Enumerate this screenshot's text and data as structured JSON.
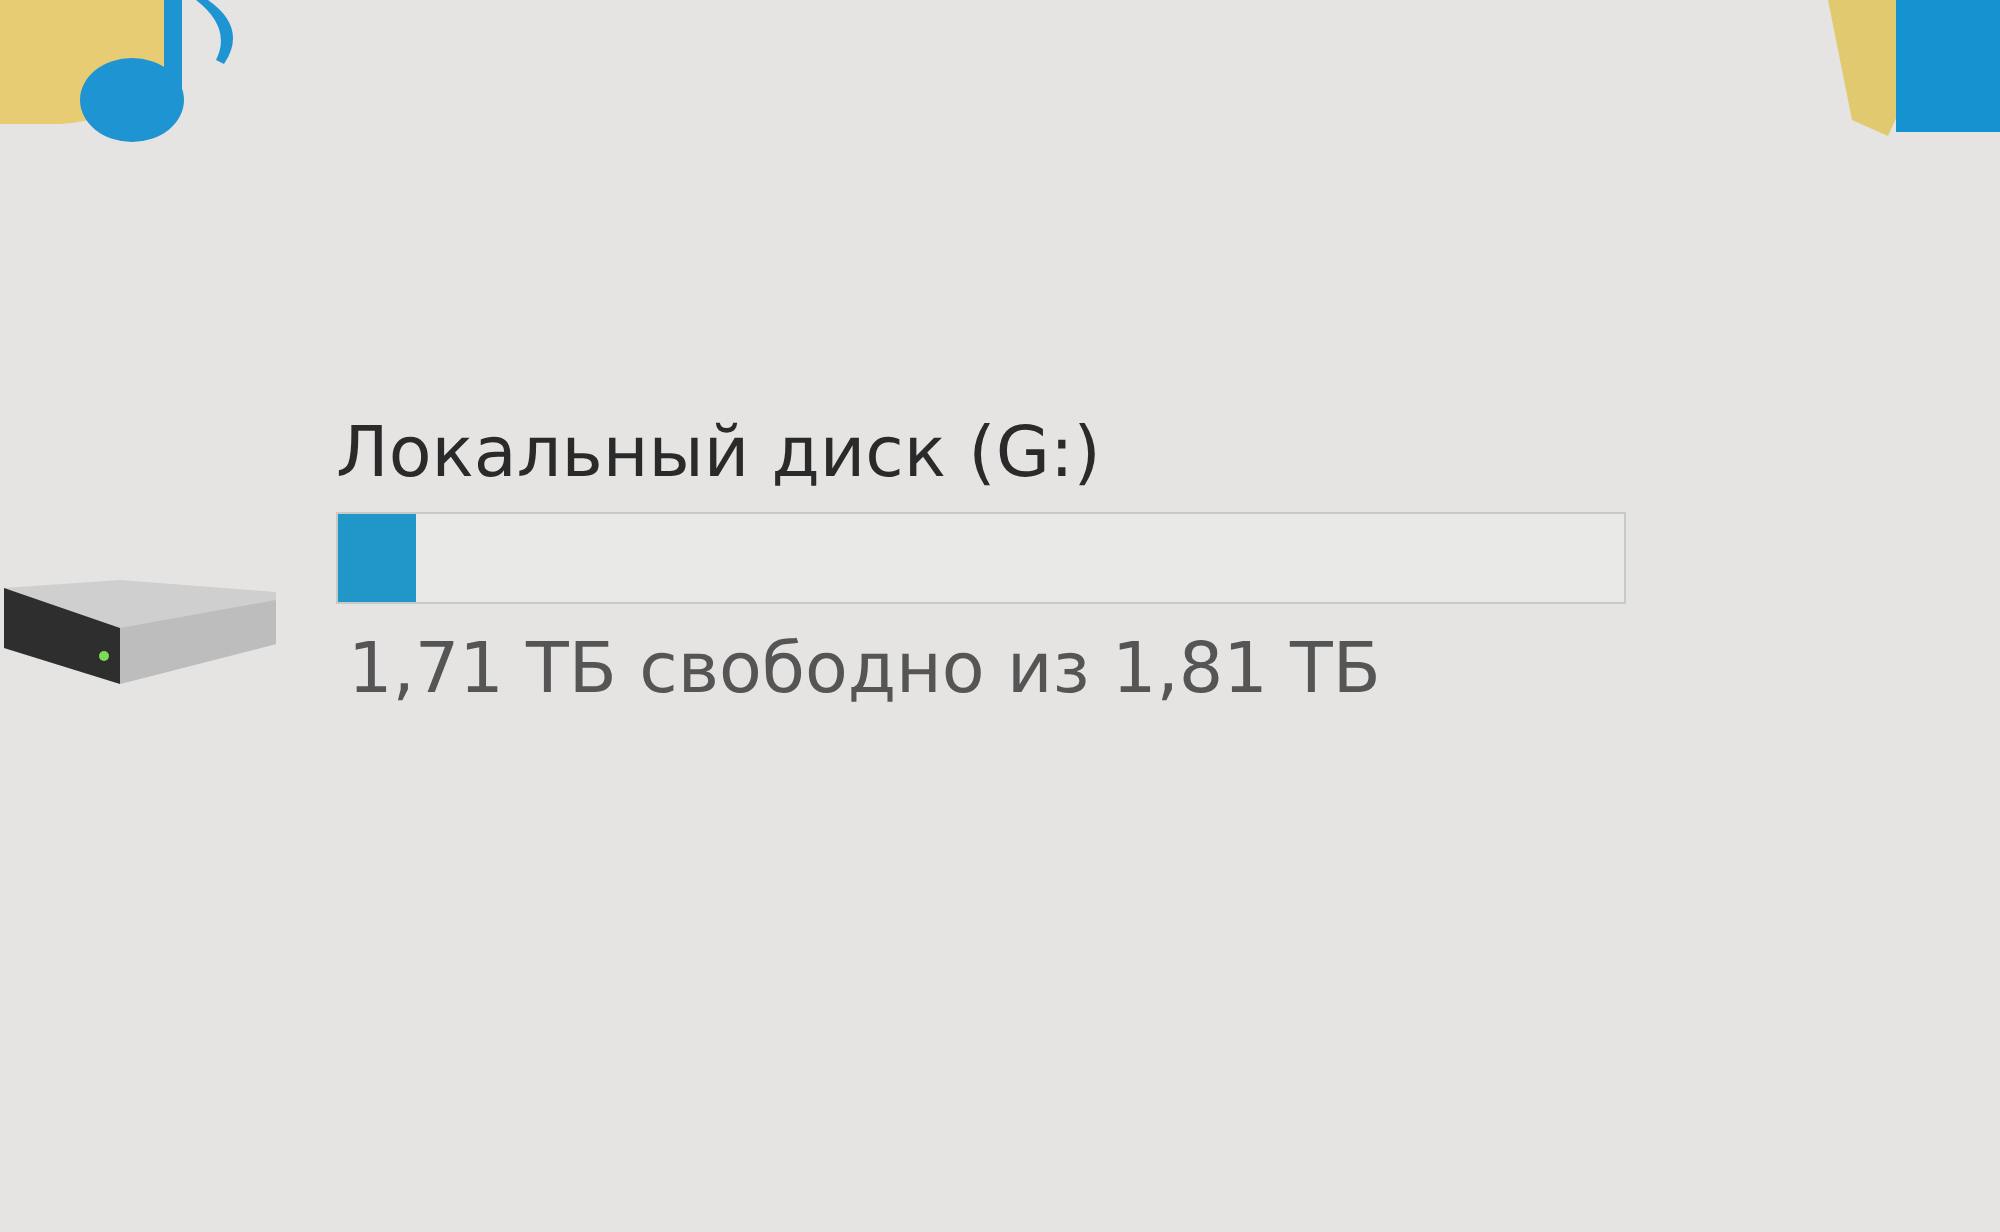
{
  "drive": {
    "label": "Локальный диск (G:)",
    "level": 0.06,
    "free_space": "1,71 ТБ свободно из 1,81 ТБ"
  }
}
